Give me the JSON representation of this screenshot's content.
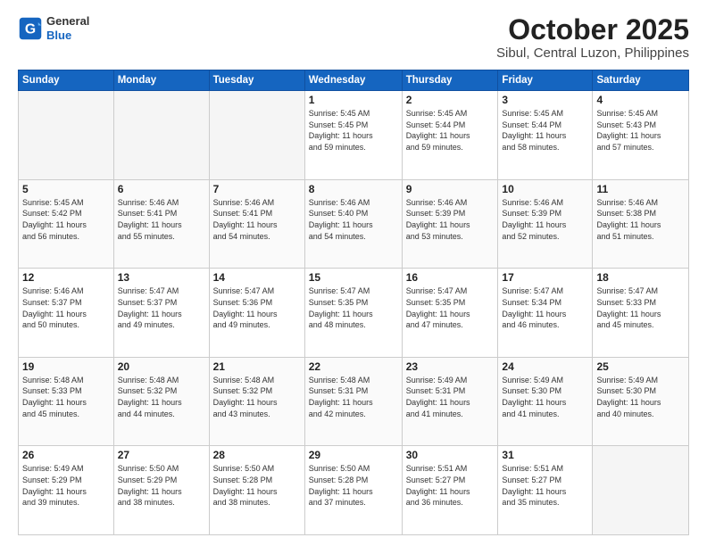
{
  "logo": {
    "line1": "General",
    "line2": "Blue"
  },
  "title": "October 2025",
  "subtitle": "Sibul, Central Luzon, Philippines",
  "weekdays": [
    "Sunday",
    "Monday",
    "Tuesday",
    "Wednesday",
    "Thursday",
    "Friday",
    "Saturday"
  ],
  "weeks": [
    [
      {
        "day": "",
        "info": ""
      },
      {
        "day": "",
        "info": ""
      },
      {
        "day": "",
        "info": ""
      },
      {
        "day": "1",
        "info": "Sunrise: 5:45 AM\nSunset: 5:45 PM\nDaylight: 11 hours\nand 59 minutes."
      },
      {
        "day": "2",
        "info": "Sunrise: 5:45 AM\nSunset: 5:44 PM\nDaylight: 11 hours\nand 59 minutes."
      },
      {
        "day": "3",
        "info": "Sunrise: 5:45 AM\nSunset: 5:44 PM\nDaylight: 11 hours\nand 58 minutes."
      },
      {
        "day": "4",
        "info": "Sunrise: 5:45 AM\nSunset: 5:43 PM\nDaylight: 11 hours\nand 57 minutes."
      }
    ],
    [
      {
        "day": "5",
        "info": "Sunrise: 5:45 AM\nSunset: 5:42 PM\nDaylight: 11 hours\nand 56 minutes."
      },
      {
        "day": "6",
        "info": "Sunrise: 5:46 AM\nSunset: 5:41 PM\nDaylight: 11 hours\nand 55 minutes."
      },
      {
        "day": "7",
        "info": "Sunrise: 5:46 AM\nSunset: 5:41 PM\nDaylight: 11 hours\nand 54 minutes."
      },
      {
        "day": "8",
        "info": "Sunrise: 5:46 AM\nSunset: 5:40 PM\nDaylight: 11 hours\nand 54 minutes."
      },
      {
        "day": "9",
        "info": "Sunrise: 5:46 AM\nSunset: 5:39 PM\nDaylight: 11 hours\nand 53 minutes."
      },
      {
        "day": "10",
        "info": "Sunrise: 5:46 AM\nSunset: 5:39 PM\nDaylight: 11 hours\nand 52 minutes."
      },
      {
        "day": "11",
        "info": "Sunrise: 5:46 AM\nSunset: 5:38 PM\nDaylight: 11 hours\nand 51 minutes."
      }
    ],
    [
      {
        "day": "12",
        "info": "Sunrise: 5:46 AM\nSunset: 5:37 PM\nDaylight: 11 hours\nand 50 minutes."
      },
      {
        "day": "13",
        "info": "Sunrise: 5:47 AM\nSunset: 5:37 PM\nDaylight: 11 hours\nand 49 minutes."
      },
      {
        "day": "14",
        "info": "Sunrise: 5:47 AM\nSunset: 5:36 PM\nDaylight: 11 hours\nand 49 minutes."
      },
      {
        "day": "15",
        "info": "Sunrise: 5:47 AM\nSunset: 5:35 PM\nDaylight: 11 hours\nand 48 minutes."
      },
      {
        "day": "16",
        "info": "Sunrise: 5:47 AM\nSunset: 5:35 PM\nDaylight: 11 hours\nand 47 minutes."
      },
      {
        "day": "17",
        "info": "Sunrise: 5:47 AM\nSunset: 5:34 PM\nDaylight: 11 hours\nand 46 minutes."
      },
      {
        "day": "18",
        "info": "Sunrise: 5:47 AM\nSunset: 5:33 PM\nDaylight: 11 hours\nand 45 minutes."
      }
    ],
    [
      {
        "day": "19",
        "info": "Sunrise: 5:48 AM\nSunset: 5:33 PM\nDaylight: 11 hours\nand 45 minutes."
      },
      {
        "day": "20",
        "info": "Sunrise: 5:48 AM\nSunset: 5:32 PM\nDaylight: 11 hours\nand 44 minutes."
      },
      {
        "day": "21",
        "info": "Sunrise: 5:48 AM\nSunset: 5:32 PM\nDaylight: 11 hours\nand 43 minutes."
      },
      {
        "day": "22",
        "info": "Sunrise: 5:48 AM\nSunset: 5:31 PM\nDaylight: 11 hours\nand 42 minutes."
      },
      {
        "day": "23",
        "info": "Sunrise: 5:49 AM\nSunset: 5:31 PM\nDaylight: 11 hours\nand 41 minutes."
      },
      {
        "day": "24",
        "info": "Sunrise: 5:49 AM\nSunset: 5:30 PM\nDaylight: 11 hours\nand 41 minutes."
      },
      {
        "day": "25",
        "info": "Sunrise: 5:49 AM\nSunset: 5:30 PM\nDaylight: 11 hours\nand 40 minutes."
      }
    ],
    [
      {
        "day": "26",
        "info": "Sunrise: 5:49 AM\nSunset: 5:29 PM\nDaylight: 11 hours\nand 39 minutes."
      },
      {
        "day": "27",
        "info": "Sunrise: 5:50 AM\nSunset: 5:29 PM\nDaylight: 11 hours\nand 38 minutes."
      },
      {
        "day": "28",
        "info": "Sunrise: 5:50 AM\nSunset: 5:28 PM\nDaylight: 11 hours\nand 38 minutes."
      },
      {
        "day": "29",
        "info": "Sunrise: 5:50 AM\nSunset: 5:28 PM\nDaylight: 11 hours\nand 37 minutes."
      },
      {
        "day": "30",
        "info": "Sunrise: 5:51 AM\nSunset: 5:27 PM\nDaylight: 11 hours\nand 36 minutes."
      },
      {
        "day": "31",
        "info": "Sunrise: 5:51 AM\nSunset: 5:27 PM\nDaylight: 11 hours\nand 35 minutes."
      },
      {
        "day": "",
        "info": ""
      }
    ]
  ]
}
